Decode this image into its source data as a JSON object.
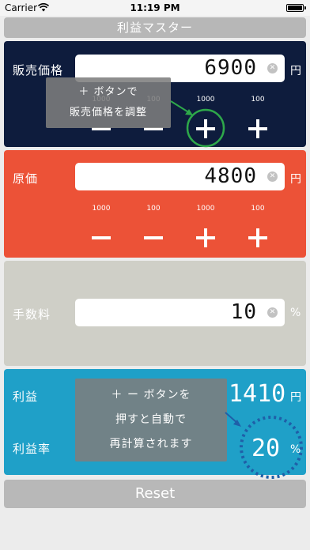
{
  "status": {
    "carrier": "Carrier",
    "time": "11:19 PM"
  },
  "app": {
    "title": "利益マスター"
  },
  "sell": {
    "label": "販売価格",
    "value": "6900",
    "unit": "円",
    "steps": [
      "1000",
      "100",
      "1000",
      "100"
    ],
    "tooltip_line1": "＋ ボタンで",
    "tooltip_line2": "販売価格を調整"
  },
  "cost": {
    "label": "原価",
    "value": "4800",
    "unit": "円",
    "steps": [
      "1000",
      "100",
      "1000",
      "100"
    ]
  },
  "fee": {
    "label": "手数料",
    "value": "10",
    "unit": "%"
  },
  "profit": {
    "label": "利益",
    "value": "1410",
    "unit": "円",
    "rate_label": "利益率",
    "rate_value": "20",
    "rate_unit": "%",
    "tooltip_line1": "＋ ー ボタンを",
    "tooltip_line2": "押すと自動で",
    "tooltip_line3": "再計算されます"
  },
  "reset_label": "Reset",
  "colors": {
    "sell_panel": "#0e1c3d",
    "cost_panel": "#ec5237",
    "fee_panel": "#cfcfc7",
    "profit_panel": "#1fa0c8",
    "highlight_green": "#2ea84a",
    "highlight_blue": "#1f5fa8"
  }
}
